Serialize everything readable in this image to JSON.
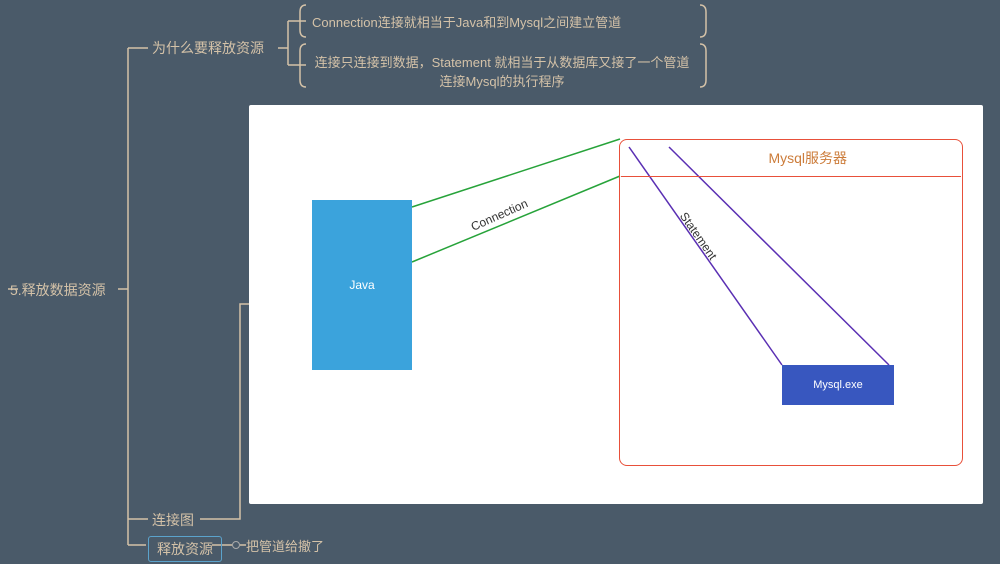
{
  "root": {
    "title": "5.释放数据资源"
  },
  "branches": {
    "why_release": {
      "label": "为什么要释放资源",
      "sub1": "Connection连接就相当于Java和到Mysql之间建立管道",
      "sub2": "连接只连接到数据，Statement 就相当于从数据库又接了一个管道连接Mysql的执行程序"
    },
    "connection_diagram": {
      "label": "连接图"
    },
    "release_resource": {
      "label": "释放资源",
      "sub1": "把管道给撤了"
    }
  },
  "diagram": {
    "java_box": "Java",
    "mysql_server": "Mysql服务器",
    "mysql_exe": "Mysql.exe",
    "connection_label": "Connection",
    "statement_label": "Statement"
  },
  "colors": {
    "bg": "#4a5a69",
    "peach": "#d4c2a8",
    "red": "#e8503a",
    "blue": "#3ba3dc",
    "darkblue": "#3857bf",
    "green": "#27a33a",
    "purple": "#5a2fb3"
  }
}
